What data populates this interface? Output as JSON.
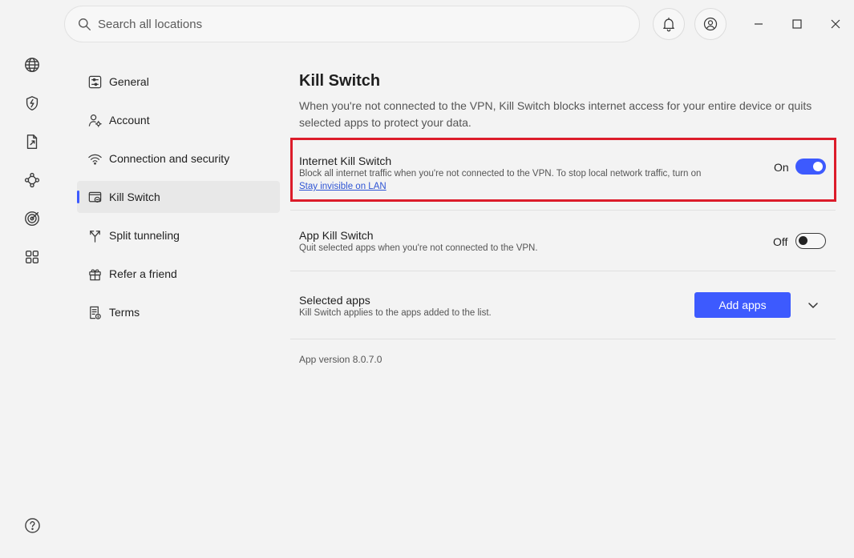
{
  "search": {
    "placeholder": "Search all locations"
  },
  "rail": {
    "icons": [
      "globe-icon",
      "shield-bolt-icon",
      "file-share-icon",
      "mesh-network-icon",
      "threat-radar-icon",
      "apps-grid-icon"
    ],
    "help_icon": "help-icon"
  },
  "window": {
    "notification_icon": "bell-icon",
    "account_icon": "user-circle-icon",
    "controls": [
      "minimize-icon",
      "maximize-icon",
      "close-icon"
    ]
  },
  "nav": {
    "items": [
      {
        "label": "General",
        "icon": "sliders-icon",
        "active": false
      },
      {
        "label": "Account",
        "icon": "user-gear-icon",
        "active": false
      },
      {
        "label": "Connection and security",
        "icon": "wifi-icon",
        "active": false
      },
      {
        "label": "Kill Switch",
        "icon": "kill-switch-icon",
        "active": true
      },
      {
        "label": "Split tunneling",
        "icon": "split-arrow-icon",
        "active": false
      },
      {
        "label": "Refer a friend",
        "icon": "gift-icon",
        "active": false
      },
      {
        "label": "Terms",
        "icon": "document-icon",
        "active": false
      }
    ]
  },
  "page": {
    "title": "Kill Switch",
    "description": "When you're not connected to the VPN, Kill Switch blocks internet access for your entire device or quits selected apps to protect your data."
  },
  "internet_kill_switch": {
    "title": "Internet Kill Switch",
    "description": "Block all internet traffic when you're not connected to the VPN. To stop local network traffic, turn on",
    "link": "Stay invisible on LAN",
    "state_label": "On",
    "enabled": true
  },
  "app_kill_switch": {
    "title": "App Kill Switch",
    "description": "Quit selected apps when you're not connected to the VPN.",
    "state_label": "Off",
    "enabled": false
  },
  "selected_apps": {
    "title": "Selected apps",
    "description": "Kill Switch applies to the apps added to the list.",
    "button_label": "Add apps"
  },
  "footer": {
    "version": "App version 8.0.7.0"
  },
  "colors": {
    "accent": "#3d5afe",
    "highlight_border": "#dc1c2a",
    "link": "#2f55d4"
  }
}
